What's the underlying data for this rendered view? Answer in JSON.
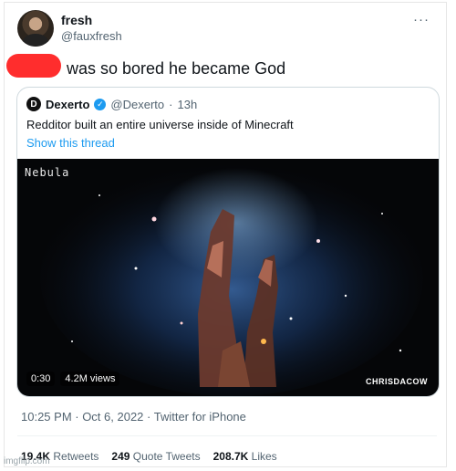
{
  "user": {
    "name": "fresh",
    "handle": "@fauxfresh"
  },
  "more_icon": "more-icon",
  "tweet": {
    "text": "was so bored he became God"
  },
  "quote": {
    "name": "Dexerto",
    "handle": "@Dexerto",
    "separator": "·",
    "time": "13h",
    "text": "Redditor built an entire universe inside of Minecraft",
    "show_thread": "Show this thread",
    "media": {
      "overlay_label": "Nebula",
      "duration": "0:30",
      "views": "4.2M views",
      "credit": "CHRISDACOW"
    }
  },
  "meta": "10:25 PM · Oct 6, 2022 · Twitter for iPhone",
  "stats": {
    "retweets_count": "19.4K",
    "retweets_label": "Retweets",
    "quotes_count": "249",
    "quotes_label": "Quote Tweets",
    "likes_count": "208.7K",
    "likes_label": "Likes"
  },
  "site_watermark": "imgflip.com",
  "colors": {
    "accent": "#1d9bf0",
    "redaction": "#ff2d2d"
  }
}
